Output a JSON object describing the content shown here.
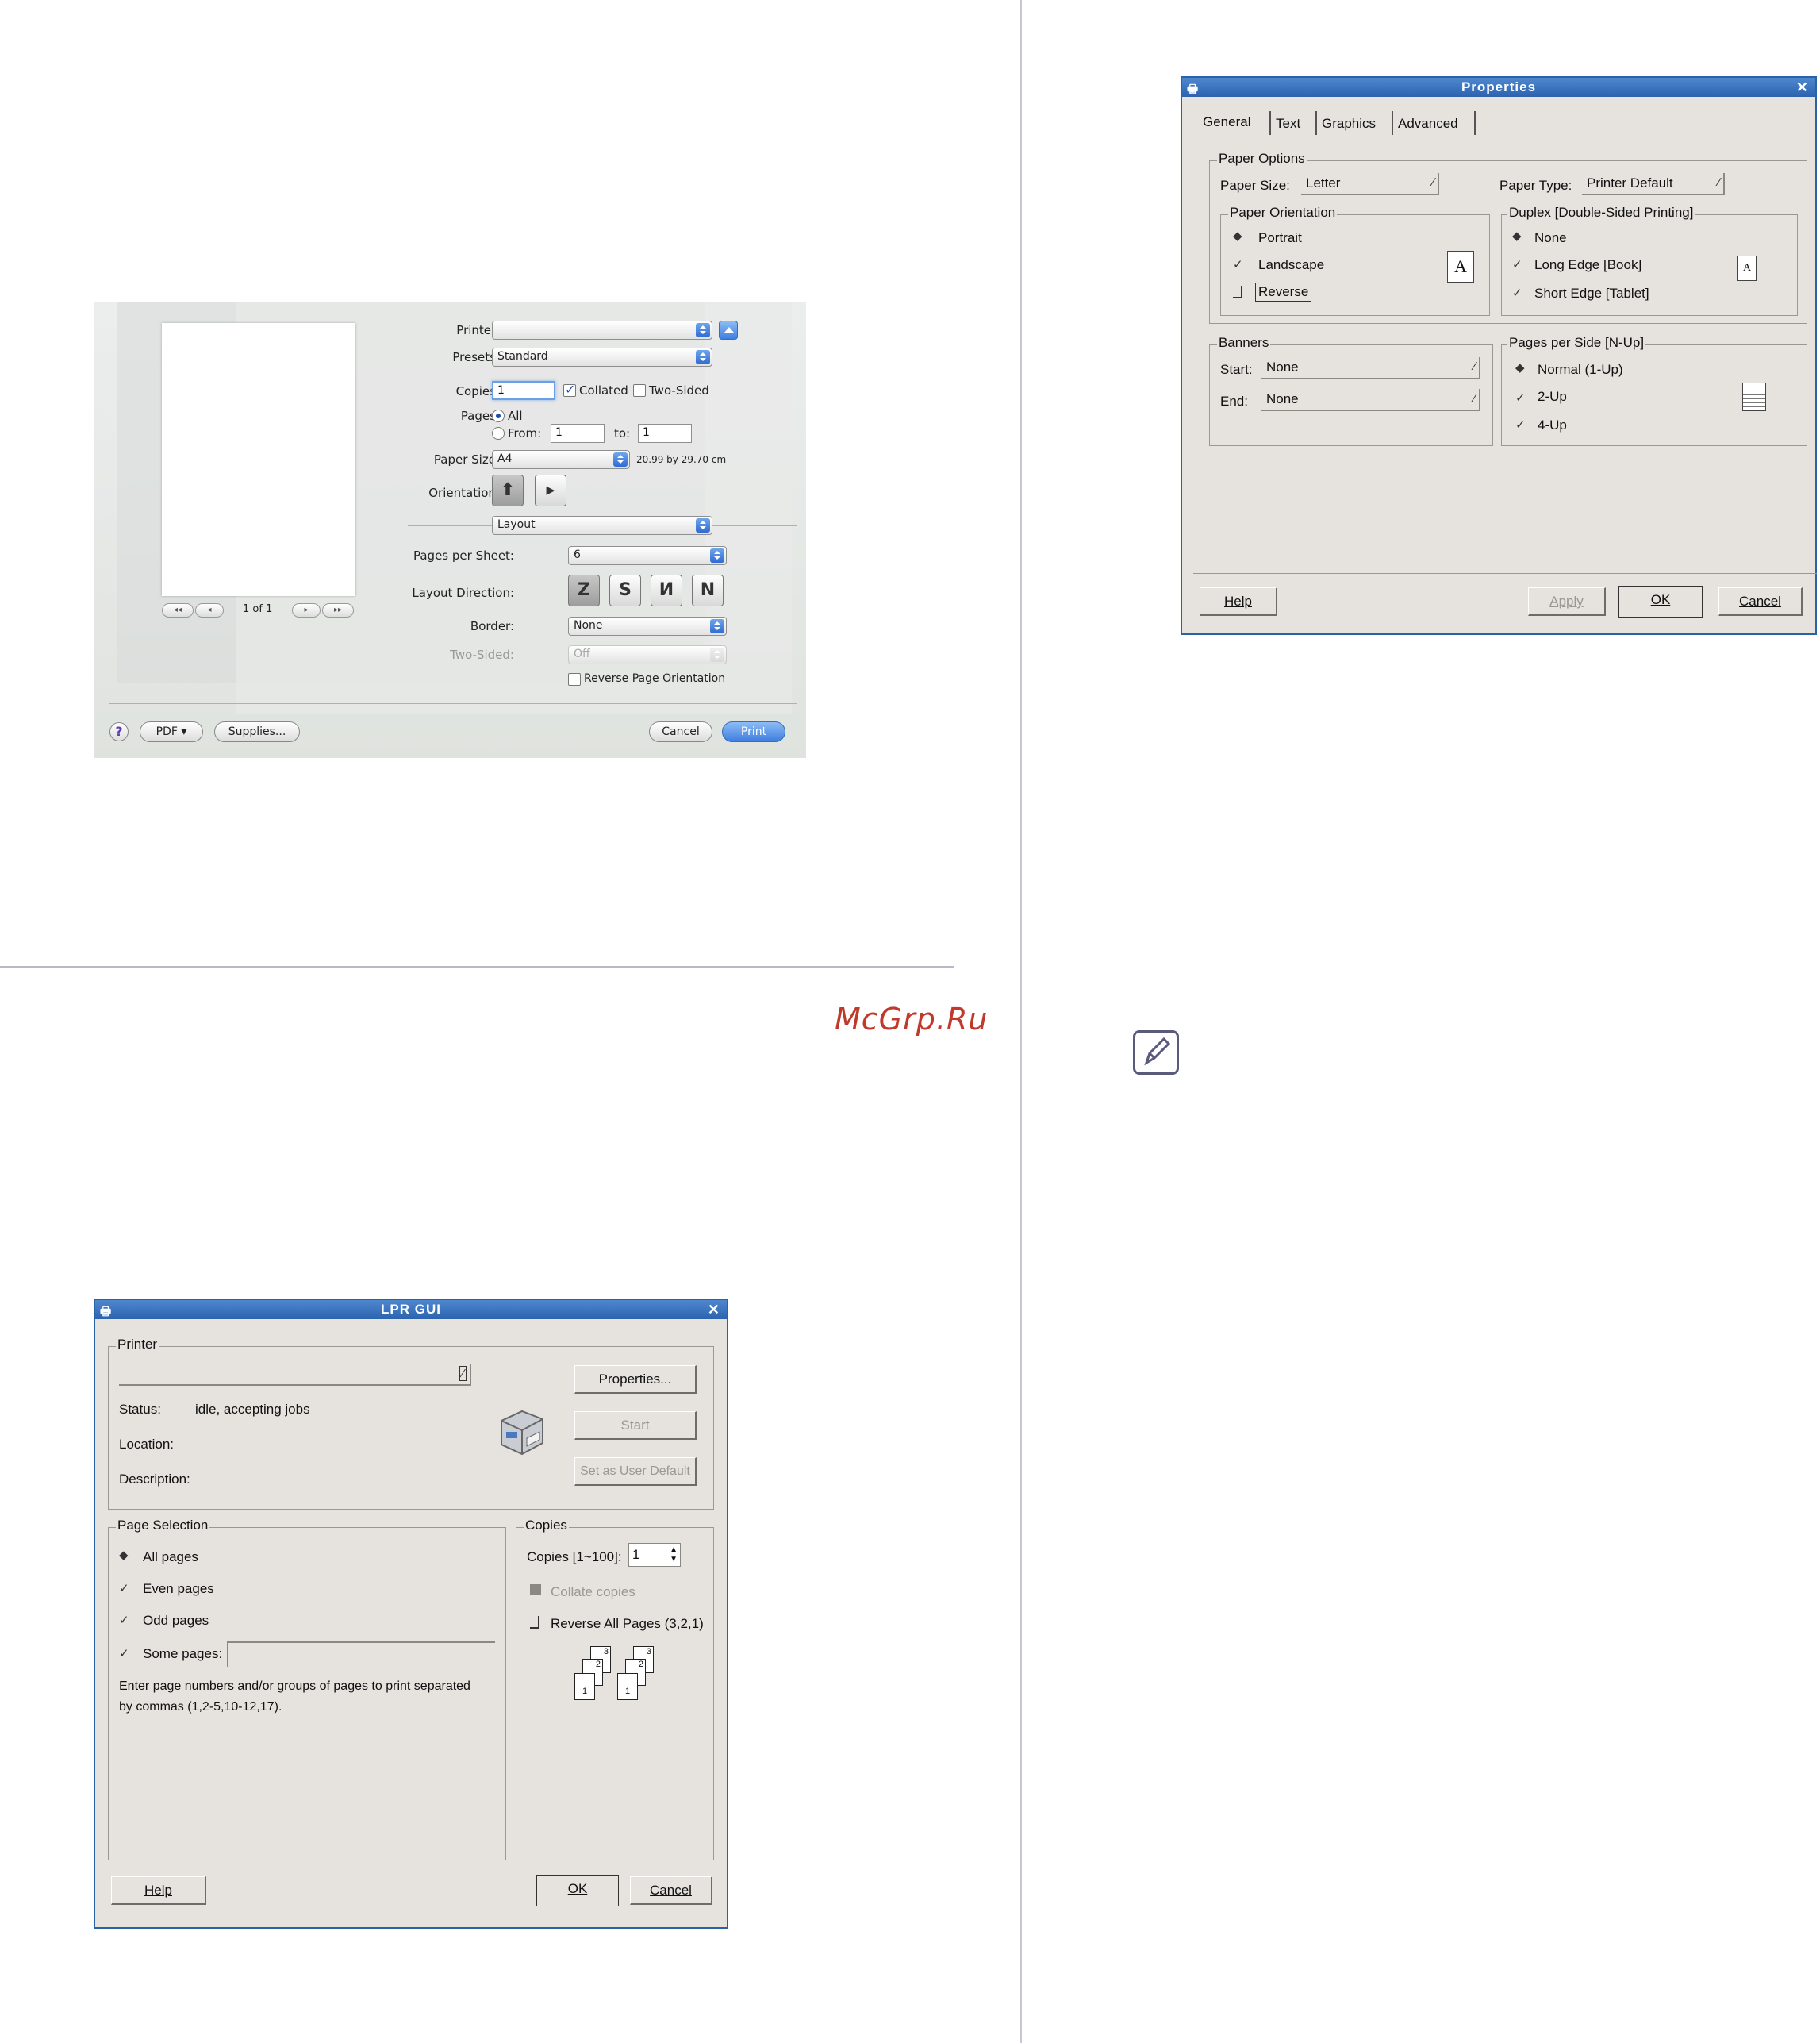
{
  "watermark": "McGrp.Ru",
  "mac_print_dialog": {
    "printer_label": "Printer:",
    "printer_value": "",
    "presets_label": "Presets:",
    "presets_value": "Standard",
    "copies_label": "Copies:",
    "copies_value": "1",
    "collated_label": "Collated",
    "two_sided_label": "Two-Sided",
    "pages_label": "Pages:",
    "pages_all": "All",
    "pages_from": "From:",
    "pages_from_value": "1",
    "pages_to": "to:",
    "pages_to_value": "1",
    "paper_size_label": "Paper Size:",
    "paper_size_value": "A4",
    "paper_size_dims": "20.99 by 29.70 cm",
    "orientation_label": "Orientation:",
    "section_value": "Layout",
    "pages_per_sheet_label": "Pages per Sheet:",
    "pages_per_sheet_value": "6",
    "layout_direction_label": "Layout Direction:",
    "layout_direction_icons": [
      "Z",
      "S",
      "И",
      "N"
    ],
    "border_label": "Border:",
    "border_value": "None",
    "two_sided_setting_label": "Two-Sided:",
    "two_sided_setting_value": "Off",
    "reverse_orientation_label": "Reverse Page Orientation",
    "page_counter": "1 of 1",
    "help_glyph": "?",
    "pdf_button": "PDF ▾",
    "supplies_button": "Supplies...",
    "cancel_button": "Cancel",
    "print_button": "Print",
    "nav_first": "◂◂",
    "nav_prev": "◂",
    "nav_next": "▸",
    "nav_last": "▸▸",
    "orientation_portrait_glyph": "⬆",
    "orientation_landscape_glyph": "▸"
  },
  "properties_dialog": {
    "title": "Properties",
    "close": "✕",
    "tabs": [
      "General",
      "Text",
      "Graphics",
      "Advanced"
    ],
    "paper_options_label": "Paper Options",
    "paper_size_label": "Paper Size:",
    "paper_size_value": "Letter",
    "paper_type_label": "Paper Type:",
    "paper_type_value": "Printer Default",
    "paper_orientation_label": "Paper Orientation",
    "portrait": "Portrait",
    "landscape": "Landscape",
    "reverse": "Reverse",
    "duplex_label": "Duplex [Double-Sided Printing]",
    "duplex_none": "None",
    "duplex_long": "Long Edge [Book]",
    "duplex_short": "Short Edge [Tablet]",
    "banners_label": "Banners",
    "start_label": "Start:",
    "start_value": "None",
    "end_label": "End:",
    "end_value": "None",
    "nup_label": "Pages per Side [N-Up]",
    "nup_normal": "Normal (1-Up)",
    "nup_2": "2-Up",
    "nup_4": "4-Up",
    "help_button": "Help",
    "apply_button": "Apply",
    "ok_button": "OK",
    "cancel_button": "Cancel",
    "preview_letter": "A"
  },
  "lpr_gui": {
    "title": "LPR GUI",
    "close": "✕",
    "printer_group": "Printer",
    "printer_value": "",
    "status_label": "Status:",
    "status_value": "idle, accepting jobs",
    "location_label": "Location:",
    "description_label": "Description:",
    "properties_button": "Properties...",
    "start_button": "Start",
    "set_default_button": "Set as User Default",
    "page_selection_label": "Page Selection",
    "all_pages": "All pages",
    "even_pages": "Even pages",
    "odd_pages": "Odd pages",
    "some_pages": "Some pages:",
    "some_pages_value": "",
    "hint_line1": "Enter page numbers and/or groups of pages to print separated",
    "hint_line2": "by commas (1,2-5,10-12,17).",
    "copies_group": "Copies",
    "copies_label": "Copies [1~100]:",
    "copies_value": "1",
    "collate_copies": "Collate copies",
    "reverse_all": "Reverse All Pages (3,2,1)",
    "help_button": "Help",
    "ok_button": "OK",
    "cancel_button": "Cancel",
    "stack_numbers": [
      "3",
      "2",
      "1"
    ]
  }
}
